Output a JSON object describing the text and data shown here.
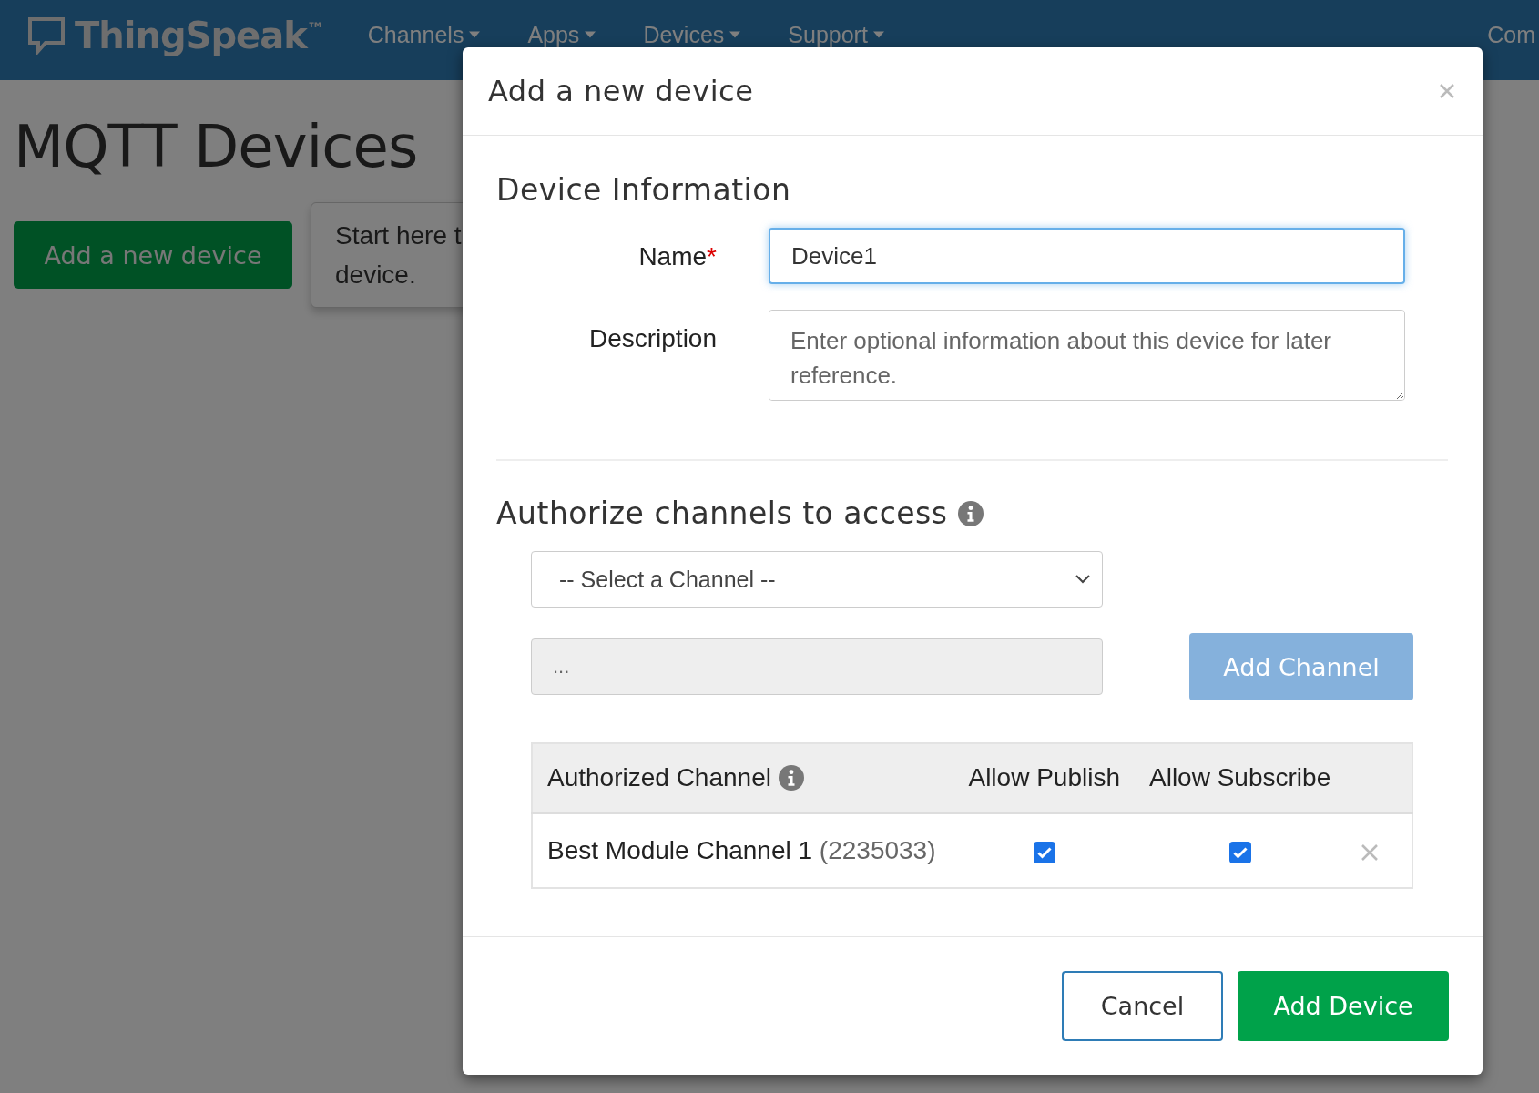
{
  "navbar": {
    "brand": "ThingSpeak",
    "brand_mark": "™",
    "menus": [
      {
        "label": "Channels"
      },
      {
        "label": "Apps"
      },
      {
        "label": "Devices"
      },
      {
        "label": "Support"
      }
    ],
    "cut_item": "Com"
  },
  "page": {
    "title": "MQTT Devices",
    "add_button": "Add a new device",
    "popover_lines": [
      "Start here t",
      "device."
    ]
  },
  "dialog": {
    "title": "Add a new device",
    "section_title": "Device Information",
    "name_field": {
      "label": "Name",
      "required_mark": "*",
      "value": "Device1",
      "focused": true
    },
    "description_field": {
      "label": "Description",
      "placeholder": "Enter optional information about this device for later reference."
    },
    "authorize_title": "Authorize channels to access",
    "channel_select": "-- Select a Channel --",
    "channel_field": {
      "placeholder": "...",
      "disabled": true
    },
    "add_channel": {
      "label": "Add Channel",
      "disabled": true
    },
    "table": {
      "columns": [
        "Authorized Channel",
        "Allow Publish",
        "Allow Subscribe"
      ],
      "rows": [
        {
          "name": "Best Module Channel 1",
          "id": "(2235033)",
          "publish": true,
          "subscribe": true
        }
      ]
    },
    "buttons": [
      {
        "label": "Cancel",
        "kind": "secondary"
      },
      {
        "label": "Add Device",
        "kind": "primary"
      }
    ]
  }
}
